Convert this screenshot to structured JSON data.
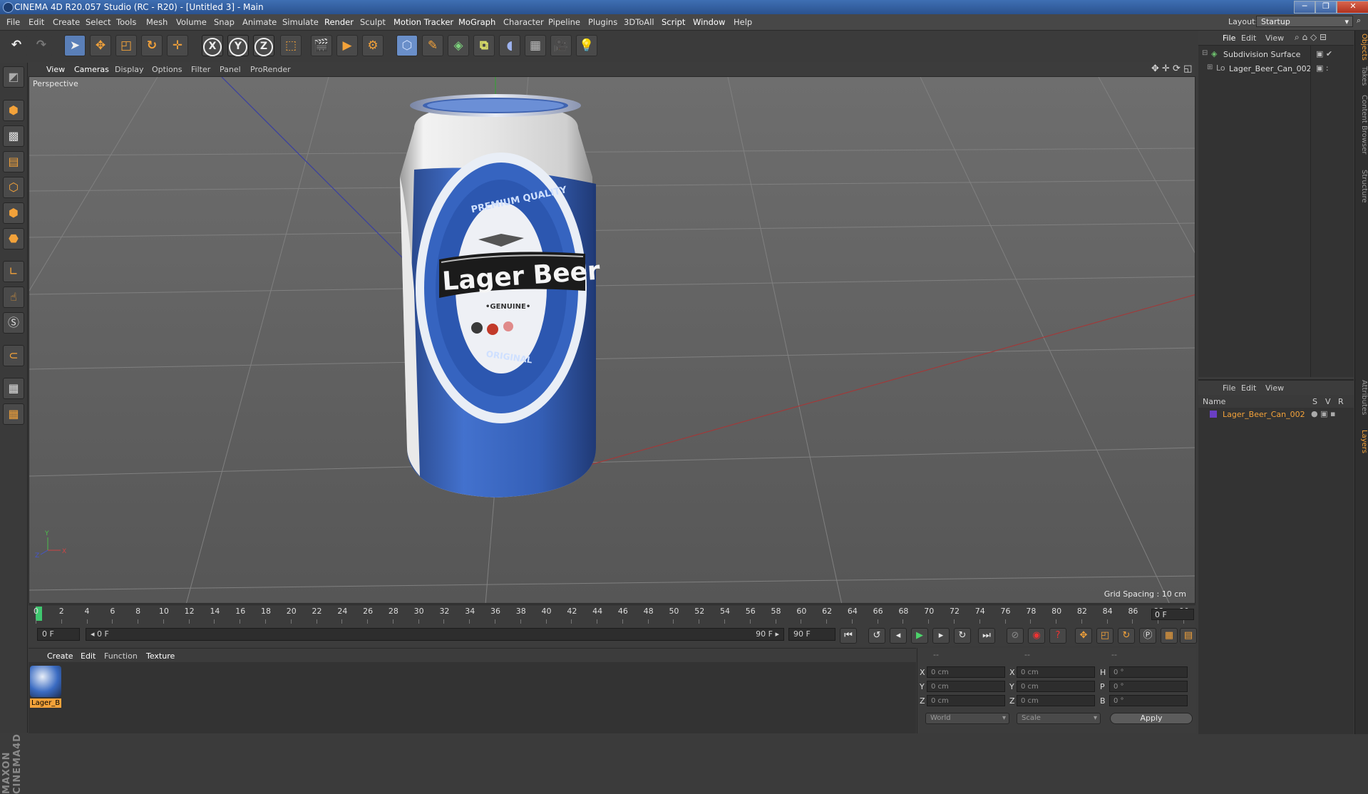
{
  "window": {
    "title": "CINEMA 4D R20.057 Studio (RC - R20) - [Untitled 3] - Main",
    "min": "─",
    "max": "❐",
    "close": "✕"
  },
  "menubar": {
    "items": [
      "File",
      "Edit",
      "Create",
      "Select",
      "Tools",
      "Mesh",
      "Volume",
      "Snap",
      "Animate",
      "Simulate",
      "Render",
      "Sculpt",
      "Motion Tracker",
      "MoGraph",
      "Character",
      "Pipeline",
      "Plugins",
      "3DToAll",
      "Script",
      "Window",
      "Help"
    ],
    "layout_label": "Layout:",
    "layout_value": "Startup"
  },
  "toolbar": {
    "axes": [
      "X",
      "Y",
      "Z"
    ]
  },
  "viewport": {
    "menu": [
      "View",
      "Cameras",
      "Display",
      "Options",
      "Filter",
      "Panel",
      "ProRender"
    ],
    "label": "Perspective",
    "grid_spacing": "Grid Spacing : 10 cm",
    "can_texts": {
      "top": "PREMIUM QUALITY",
      "brand": "Lager  Beer",
      "sub": "•GENUINE•",
      "bottom": "ORIGINAL"
    },
    "axis": {
      "x": "X",
      "y": "Y",
      "z": "Z"
    }
  },
  "timeline": {
    "ticks": [
      "0",
      "2",
      "4",
      "6",
      "8",
      "10",
      "12",
      "14",
      "16",
      "18",
      "20",
      "22",
      "24",
      "26",
      "28",
      "30",
      "32",
      "34",
      "36",
      "38",
      "40",
      "42",
      "44",
      "46",
      "48",
      "50",
      "52",
      "54",
      "56",
      "58",
      "60",
      "62",
      "64",
      "66",
      "68",
      "70",
      "72",
      "74",
      "76",
      "78",
      "80",
      "82",
      "84",
      "86",
      "88",
      "90"
    ],
    "current_frame": "0 F",
    "start_field": "0 F",
    "range_start": "◂ 0 F",
    "range_end": "90 F ▸",
    "end_field": "90 F"
  },
  "material_manager": {
    "menu": [
      "Create",
      "Edit",
      "Function",
      "Texture"
    ],
    "materials": [
      {
        "name": "Lager_B"
      }
    ]
  },
  "coordinates": {
    "headers": [
      "--",
      "--",
      "--"
    ],
    "rows": [
      {
        "l1": "X",
        "v1": "0 cm",
        "l2": "X",
        "v2": "0 cm",
        "l3": "H",
        "v3": "0 °"
      },
      {
        "l1": "Y",
        "v1": "0 cm",
        "l2": "Y",
        "v2": "0 cm",
        "l3": "P",
        "v3": "0 °"
      },
      {
        "l1": "Z",
        "v1": "0 cm",
        "l2": "Z",
        "v2": "0 cm",
        "l3": "B",
        "v3": "0 °"
      }
    ],
    "mode1": "World",
    "mode2": "Scale",
    "apply": "Apply"
  },
  "object_manager": {
    "menu": [
      "File",
      "Edit",
      "View"
    ],
    "objects": [
      {
        "name": "Subdivision Surface"
      },
      {
        "name": "Lager_Beer_Can_002"
      }
    ]
  },
  "layer_manager": {
    "menu": [
      "File",
      "Edit",
      "View"
    ],
    "columns": {
      "name": "Name",
      "s": "S",
      "v": "V",
      "r": "R"
    },
    "layers": [
      {
        "name": "Lager_Beer_Can_002"
      }
    ]
  },
  "side_tabs": [
    "Objects",
    "Takes",
    "Content Browser",
    "Structure",
    "Attributes",
    "Layers"
  ],
  "brand": "MAXON CINEMA4D",
  "colors": {
    "accent": "#f3a23a",
    "can_blue": "#2f5db5",
    "can_white": "#e8e8e8",
    "title_bar": "#2f5a9c"
  }
}
